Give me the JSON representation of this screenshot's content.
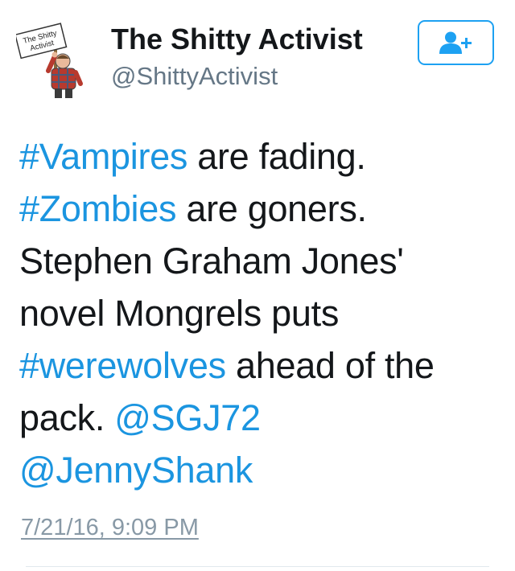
{
  "tweet": {
    "author": {
      "display_name": "The Shitty Activist",
      "handle": "@ShittyActivist",
      "avatar_sign_text": "The Shitty Activist",
      "avatar_icon": "activist-holding-sign-avatar"
    },
    "follow_button": {
      "icon": "add-user-icon",
      "color": "#1da1f2"
    },
    "text_lines": [
      [
        {
          "text": "#Vampires",
          "type": "hashtag"
        },
        {
          "text": " are fading.",
          "type": "text"
        }
      ],
      [
        {
          "text": "#Zombies",
          "type": "hashtag"
        },
        {
          "text": " are goners.",
          "type": "text"
        }
      ],
      [
        {
          "text": "Stephen Graham Jones'",
          "type": "text"
        }
      ],
      [
        {
          "text": "novel Mongrels puts",
          "type": "text"
        }
      ],
      [
        {
          "text": "#werewolves",
          "type": "hashtag"
        },
        {
          "text": " ahead of the",
          "type": "text"
        }
      ],
      [
        {
          "text": "pack. ",
          "type": "text"
        },
        {
          "text": "@SGJ72",
          "type": "mention"
        }
      ],
      [
        {
          "text": "@JennyShank",
          "type": "mention"
        }
      ]
    ],
    "timestamp": "7/21/16, 9:09 PM",
    "link_color": "#1b95e0"
  }
}
